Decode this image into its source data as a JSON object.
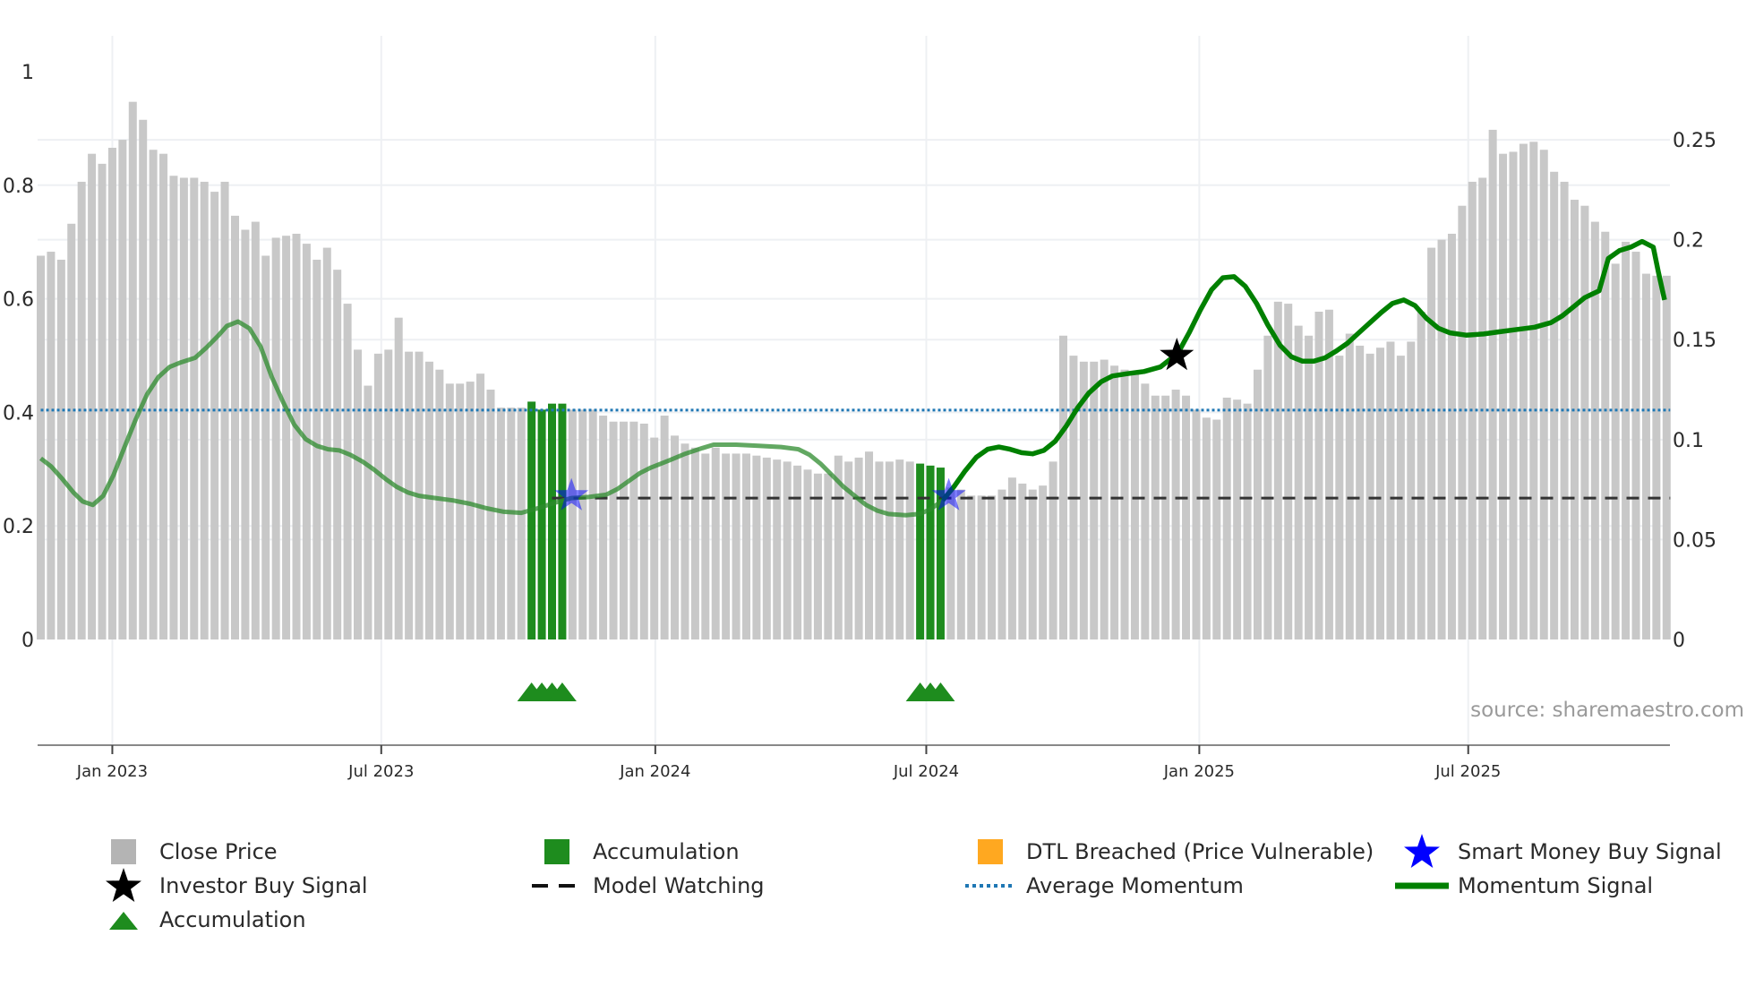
{
  "chart_data": {
    "type": "bar",
    "title": "",
    "x_unit": "week index",
    "x_ticks": [
      {
        "label": "Jan 2023",
        "pos": 7.0
      },
      {
        "label": "Jul 2023",
        "pos": 33.3
      },
      {
        "label": "Jan 2024",
        "pos": 60.1
      },
      {
        "label": "Jul 2024",
        "pos": 86.6
      },
      {
        "label": "Jan 2025",
        "pos": 113.3
      },
      {
        "label": "Jul 2025",
        "pos": 139.6
      }
    ],
    "left_axis": {
      "ticks": [
        0,
        0.2,
        0.4,
        0.6,
        0.8,
        1
      ],
      "labels": [
        "0",
        "0.2",
        "0.4",
        "0.6",
        "0.8",
        "1"
      ],
      "ylim": [
        -0.185,
        1.07
      ]
    },
    "right_axis": {
      "ticks": [
        0,
        0.05,
        0.1,
        0.15,
        0.2,
        0.25
      ],
      "labels": [
        "0",
        "0.05",
        "0.1",
        "0.15",
        "0.2",
        "0.25"
      ],
      "ylim": [
        -0.0526,
        0.304
      ]
    },
    "close_price": [
      0.192,
      0.194,
      0.19,
      0.208,
      0.229,
      0.243,
      0.238,
      0.246,
      0.25,
      0.269,
      0.26,
      0.245,
      0.243,
      0.232,
      0.231,
      0.231,
      0.229,
      0.224,
      0.229,
      0.212,
      0.205,
      0.209,
      0.192,
      0.201,
      0.202,
      0.203,
      0.198,
      0.19,
      0.196,
      0.185,
      0.168,
      0.145,
      0.127,
      0.143,
      0.145,
      0.161,
      0.144,
      0.144,
      0.139,
      0.135,
      0.128,
      0.128,
      0.129,
      0.133,
      0.125,
      0.116,
      0.116,
      0.116,
      0.119,
      0.115,
      0.118,
      0.118,
      0.115,
      0.115,
      0.115,
      0.112,
      0.109,
      0.109,
      0.109,
      0.108,
      0.101,
      0.112,
      0.102,
      0.098,
      0.096,
      0.093,
      0.096,
      0.093,
      0.093,
      0.093,
      0.092,
      0.091,
      0.09,
      0.089,
      0.087,
      0.085,
      0.083,
      0.083,
      0.092,
      0.089,
      0.091,
      0.094,
      0.089,
      0.089,
      0.09,
      0.089,
      0.088,
      0.087,
      0.086,
      0.076,
      0.075,
      0.072,
      0.072,
      0.072,
      0.075,
      0.081,
      0.078,
      0.075,
      0.077,
      0.089,
      0.152,
      0.142,
      0.139,
      0.139,
      0.14,
      0.137,
      0.135,
      0.134,
      0.128,
      0.122,
      0.122,
      0.125,
      0.122,
      0.115,
      0.111,
      0.11,
      0.121,
      0.12,
      0.118,
      0.135,
      0.152,
      0.169,
      0.168,
      0.157,
      0.152,
      0.164,
      0.165,
      0.142,
      0.153,
      0.147,
      0.143,
      0.146,
      0.149,
      0.142,
      0.149,
      0.164,
      0.196,
      0.2,
      0.203,
      0.217,
      0.229,
      0.231,
      0.255,
      0.243,
      0.244,
      0.248,
      0.249,
      0.245,
      0.234,
      0.229,
      0.22,
      0.217,
      0.209,
      0.204,
      0.188,
      0.199,
      0.194,
      0.183,
      0.182,
      0.182
    ],
    "accumulation_weeks": [
      48,
      49,
      50,
      51,
      86,
      87,
      88
    ],
    "accumulation_markers": [
      48,
      49,
      50,
      51,
      86,
      87,
      88
    ],
    "accumulation_marker_level": -0.09,
    "momentum_signal": [
      [
        0,
        0.319
      ],
      [
        1,
        0.305
      ],
      [
        2.1,
        0.283
      ],
      [
        3.2,
        0.259
      ],
      [
        4.1,
        0.243
      ],
      [
        5.1,
        0.237
      ],
      [
        6.1,
        0.253
      ],
      [
        7.1,
        0.289
      ],
      [
        8.2,
        0.339
      ],
      [
        9.3,
        0.388
      ],
      [
        10.4,
        0.432
      ],
      [
        11.5,
        0.462
      ],
      [
        12.6,
        0.48
      ],
      [
        13.7,
        0.488
      ],
      [
        15.1,
        0.496
      ],
      [
        16.2,
        0.514
      ],
      [
        17.3,
        0.534
      ],
      [
        18.2,
        0.552
      ],
      [
        19.3,
        0.56
      ],
      [
        20.4,
        0.548
      ],
      [
        21.5,
        0.516
      ],
      [
        22.6,
        0.462
      ],
      [
        23.7,
        0.418
      ],
      [
        24.8,
        0.378
      ],
      [
        25.9,
        0.353
      ],
      [
        27,
        0.341
      ],
      [
        28.1,
        0.335
      ],
      [
        29.2,
        0.333
      ],
      [
        30.3,
        0.325
      ],
      [
        31.5,
        0.313
      ],
      [
        32.6,
        0.299
      ],
      [
        33.7,
        0.283
      ],
      [
        34.8,
        0.269
      ],
      [
        35.9,
        0.259
      ],
      [
        37,
        0.253
      ],
      [
        38.6,
        0.249
      ],
      [
        40.3,
        0.245
      ],
      [
        42,
        0.239
      ],
      [
        43.6,
        0.231
      ],
      [
        45.3,
        0.225
      ],
      [
        47,
        0.223
      ],
      [
        48.6,
        0.231
      ],
      [
        50.3,
        0.241
      ],
      [
        51.9,
        0.249
      ],
      [
        53.6,
        0.251
      ],
      [
        55.3,
        0.255
      ],
      [
        56.4,
        0.265
      ],
      [
        57.5,
        0.279
      ],
      [
        58.6,
        0.293
      ],
      [
        59.7,
        0.303
      ],
      [
        61.4,
        0.315
      ],
      [
        63,
        0.327
      ],
      [
        64.7,
        0.337
      ],
      [
        65.8,
        0.343
      ],
      [
        68,
        0.343
      ],
      [
        70.2,
        0.341
      ],
      [
        72.4,
        0.339
      ],
      [
        74.1,
        0.335
      ],
      [
        75.2,
        0.325
      ],
      [
        76.3,
        0.309
      ],
      [
        77.4,
        0.289
      ],
      [
        78.5,
        0.269
      ],
      [
        79.6,
        0.253
      ],
      [
        80.7,
        0.237
      ],
      [
        81.8,
        0.227
      ],
      [
        82.9,
        0.221
      ],
      [
        84.6,
        0.219
      ],
      [
        85.9,
        0.221
      ],
      [
        87,
        0.229
      ],
      [
        88.2,
        0.245
      ],
      [
        89.3,
        0.269
      ],
      [
        90.4,
        0.297
      ],
      [
        91.5,
        0.321
      ],
      [
        92.6,
        0.335
      ],
      [
        93.7,
        0.339
      ],
      [
        94.8,
        0.335
      ],
      [
        95.9,
        0.329
      ],
      [
        97,
        0.327
      ],
      [
        98.1,
        0.333
      ],
      [
        99.2,
        0.349
      ],
      [
        100.3,
        0.376
      ],
      [
        101.4,
        0.408
      ],
      [
        102.5,
        0.434
      ],
      [
        103.7,
        0.454
      ],
      [
        104.8,
        0.464
      ],
      [
        106.2,
        0.468
      ],
      [
        107.9,
        0.472
      ],
      [
        109.5,
        0.48
      ],
      [
        111.2,
        0.504
      ],
      [
        112.3,
        0.54
      ],
      [
        113.4,
        0.58
      ],
      [
        114.5,
        0.616
      ],
      [
        115.6,
        0.637
      ],
      [
        116.7,
        0.639
      ],
      [
        117.8,
        0.622
      ],
      [
        118.9,
        0.592
      ],
      [
        120,
        0.554
      ],
      [
        121.2,
        0.518
      ],
      [
        122.3,
        0.498
      ],
      [
        123.4,
        0.49
      ],
      [
        124.5,
        0.49
      ],
      [
        125.6,
        0.496
      ],
      [
        126.7,
        0.508
      ],
      [
        127.8,
        0.522
      ],
      [
        128.9,
        0.54
      ],
      [
        130,
        0.558
      ],
      [
        131.1,
        0.576
      ],
      [
        132.2,
        0.592
      ],
      [
        133.3,
        0.598
      ],
      [
        134.4,
        0.588
      ],
      [
        135.5,
        0.566
      ],
      [
        136.7,
        0.548
      ],
      [
        137.8,
        0.54
      ],
      [
        139.4,
        0.536
      ],
      [
        141.1,
        0.538
      ],
      [
        142.7,
        0.542
      ],
      [
        144.4,
        0.546
      ],
      [
        146.1,
        0.55
      ],
      [
        147.7,
        0.558
      ],
      [
        148.8,
        0.57
      ],
      [
        149.9,
        0.586
      ],
      [
        151,
        0.602
      ],
      [
        152.4,
        0.614
      ],
      [
        153.3,
        0.671
      ],
      [
        154.4,
        0.685
      ],
      [
        155.5,
        0.691
      ],
      [
        156.6,
        0.701
      ],
      [
        157.7,
        0.691
      ],
      [
        158.2,
        0.647
      ],
      [
        158.8,
        0.598
      ]
    ],
    "momentum_faded_until": 88.2,
    "average_momentum": 0.404,
    "model_watching": {
      "level": 0.249,
      "from_week": 50
    },
    "smart_money_buy_signals": [
      [
        51.9,
        0.253
      ],
      [
        88.8,
        0.253
      ]
    ],
    "investor_buy_signals": [
      [
        111.1,
        0.5
      ]
    ],
    "source_note": "source: sharemaestro.com",
    "colors": {
      "close_price": "#c8c8c8",
      "accumulation": "#1e8c1e",
      "dtl": "#ffa820",
      "smart_money": "#0000ff",
      "investor": "#000000",
      "avg_momentum": "#1f77b4",
      "momentum": "#008000"
    },
    "legend": {
      "placement": "bottom",
      "items": [
        {
          "label": "Close Price",
          "icon": "gray-square"
        },
        {
          "label": "Accumulation",
          "icon": "green-square"
        },
        {
          "label": "DTL Breached (Price Vulnerable)",
          "icon": "orange-square"
        },
        {
          "label": "Smart Money Buy Signal",
          "icon": "blue-star"
        },
        {
          "label": "Investor Buy Signal",
          "icon": "black-star"
        },
        {
          "label": "Model Watching",
          "icon": "dashed-line"
        },
        {
          "label": "Average Momentum",
          "icon": "dotted-line"
        },
        {
          "label": "Momentum Signal",
          "icon": "green-line"
        },
        {
          "label": "Accumulation",
          "icon": "green-triangle"
        }
      ]
    }
  }
}
